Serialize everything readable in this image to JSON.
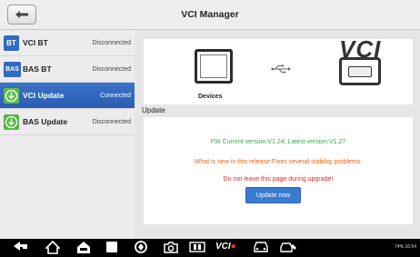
{
  "header": {
    "title": "VCI Manager"
  },
  "sidebar": {
    "items": [
      {
        "badge": "BT",
        "label": "VCI BT",
        "status": "Disconnected"
      },
      {
        "badge": "BAS",
        "label": "BAS BT",
        "status": "Disconnected"
      },
      {
        "badge": "",
        "label": "VCI Update",
        "status": "Connected"
      },
      {
        "badge": "",
        "label": "BAS Update",
        "status": "Disconnected"
      }
    ]
  },
  "main": {
    "devices_label": "Devices",
    "vci_logo": "VCI",
    "update_heading": "Update",
    "fw_version": "FW Current version:V1.24; Latest version:V1.27",
    "whats_new": "What is new in this release:Fixes several stability problems.",
    "warning": "Do not leave this page during upgrade!",
    "update_button": "Update now"
  },
  "navbar": {
    "vci_label": "VCI",
    "status": "74% 16:54"
  },
  "colors": {
    "active": "#2f67bf",
    "green_text": "#3aa94a",
    "orange_text": "#e2651a",
    "red_text": "#e32a1e",
    "button": "#3a7bd2"
  }
}
